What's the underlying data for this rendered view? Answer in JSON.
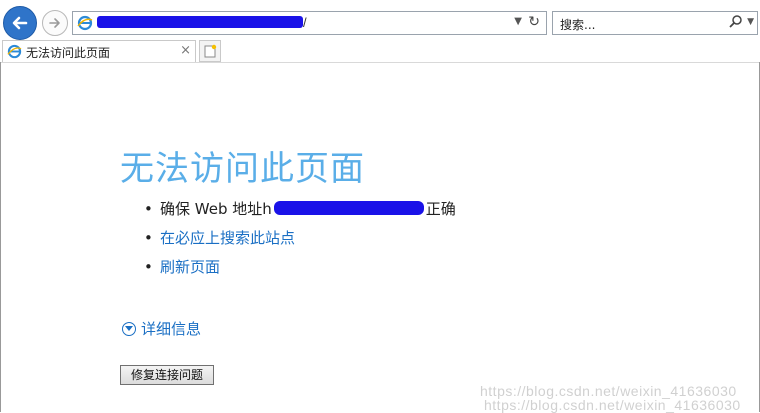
{
  "browser": {
    "url_suffix": "/",
    "search_placeholder": "搜索...",
    "tab_title": "无法访问此页面"
  },
  "page": {
    "heading": "无法访问此页面",
    "tips": [
      {
        "prefix": "确保 Web 地址h",
        "suffix": "正确"
      },
      {
        "text": "在必应上搜索此站点"
      },
      {
        "text": "刷新页面"
      }
    ],
    "details_label": "详细信息",
    "fix_button": "修复连接问题"
  },
  "watermark": "https://blog.csdn.net/weixin_41636030",
  "colors": {
    "heading": "#5aaee8",
    "link": "#1a6fc4",
    "back_button": "#2f74c9",
    "redaction": "#1a12e8"
  }
}
